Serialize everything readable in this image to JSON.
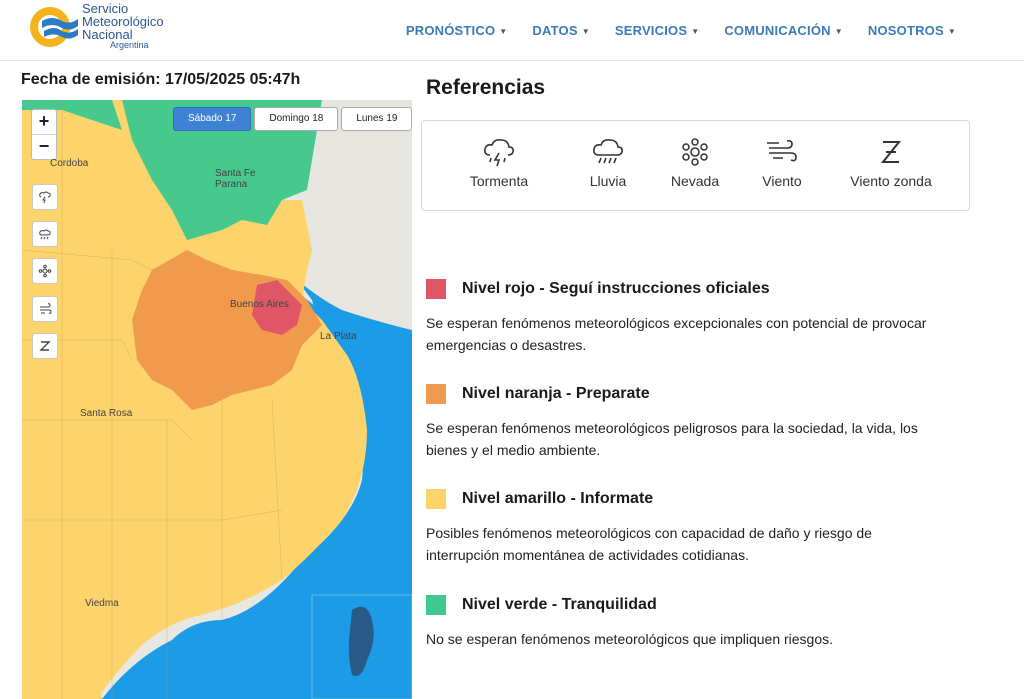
{
  "header": {
    "logo_line1": "Servicio",
    "logo_line2": "Meteorológico",
    "logo_line3": "Nacional",
    "logo_line4": "Argentina",
    "nav": [
      "PRONÓSTICO",
      "DATOS",
      "SERVICIOS",
      "COMUNICACIÓN",
      "NOSOTROS"
    ]
  },
  "emission": "Fecha de emisión: 17/05/2025 05:47h",
  "map": {
    "zoom_in": "+",
    "zoom_out": "−",
    "days": [
      "Sábado 17",
      "Domingo 18",
      "Lunes 19"
    ],
    "active_day": "Sábado 17",
    "cities": [
      "Cordoba",
      "Santa Fe",
      "Parana",
      "Buenos Aires",
      "La Plata",
      "Santa Rosa",
      "Viedma"
    ],
    "layer_buttons": [
      "storm-icon",
      "rain-icon",
      "snow-icon",
      "wind-icon",
      "zonda-icon"
    ]
  },
  "references": {
    "title": "Referencias",
    "items": [
      "Tormenta",
      "Lluvia",
      "Nevada",
      "Viento",
      "Viento zonda"
    ]
  },
  "levels": [
    {
      "title": "Nivel rojo - Seguí instrucciones oficiales",
      "color": "#df5766",
      "desc": "Se esperan fenómenos meteorológicos excepcionales con potencial de provocar emergencias o desastres."
    },
    {
      "title": "Nivel naranja - Preparate",
      "color": "#f09a4d",
      "desc": "Se esperan fenómenos meteorológicos peligrosos para la sociedad, la vida, los bienes y el medio ambiente."
    },
    {
      "title": "Nivel amarillo - Informate",
      "color": "#fcd46b",
      "desc": "Posibles fenómenos meteorológicos con capacidad de daño y riesgo de interrupción momentánea de actividades cotidianas."
    },
    {
      "title": "Nivel verde - Tranquilidad",
      "color": "#3ec98e",
      "desc": "No se esperan fenómenos meteorológicos que impliquen riesgos."
    }
  ]
}
